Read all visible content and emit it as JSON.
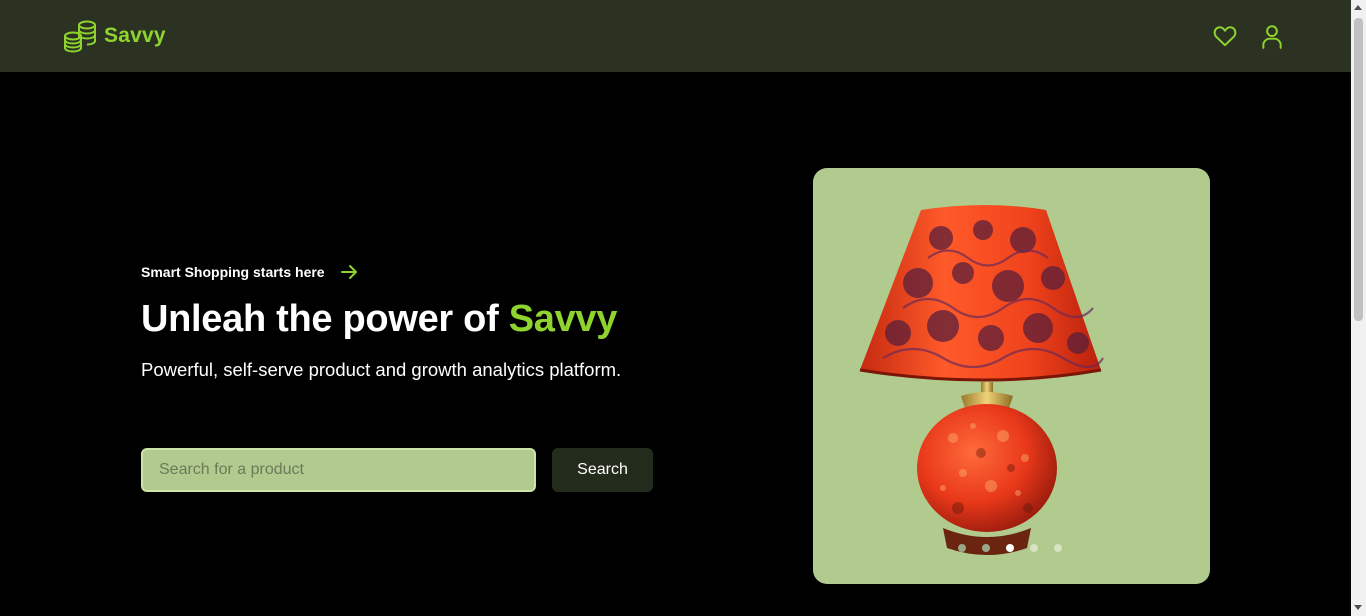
{
  "brand": {
    "name": "Savvy",
    "icon": "coins-stack-icon",
    "color": "#8fd42e"
  },
  "nav": {
    "icons": [
      "heart-icon",
      "user-icon"
    ]
  },
  "hero": {
    "eyebrow": "Smart Shopping starts here",
    "headline_prefix": "Unleah the power of ",
    "headline_accent": "Savvy",
    "subheadline": "Powerful, self-serve product and growth analytics platform."
  },
  "search": {
    "placeholder": "Search for a product",
    "value": "",
    "button_label": "Search"
  },
  "carousel": {
    "image": "table-lamp",
    "slide_count": 5,
    "active_index": 2
  },
  "colors": {
    "navbar": "#2b3221",
    "accent": "#8fd42e",
    "card": "#b1ca8d",
    "button": "#232b1c"
  }
}
